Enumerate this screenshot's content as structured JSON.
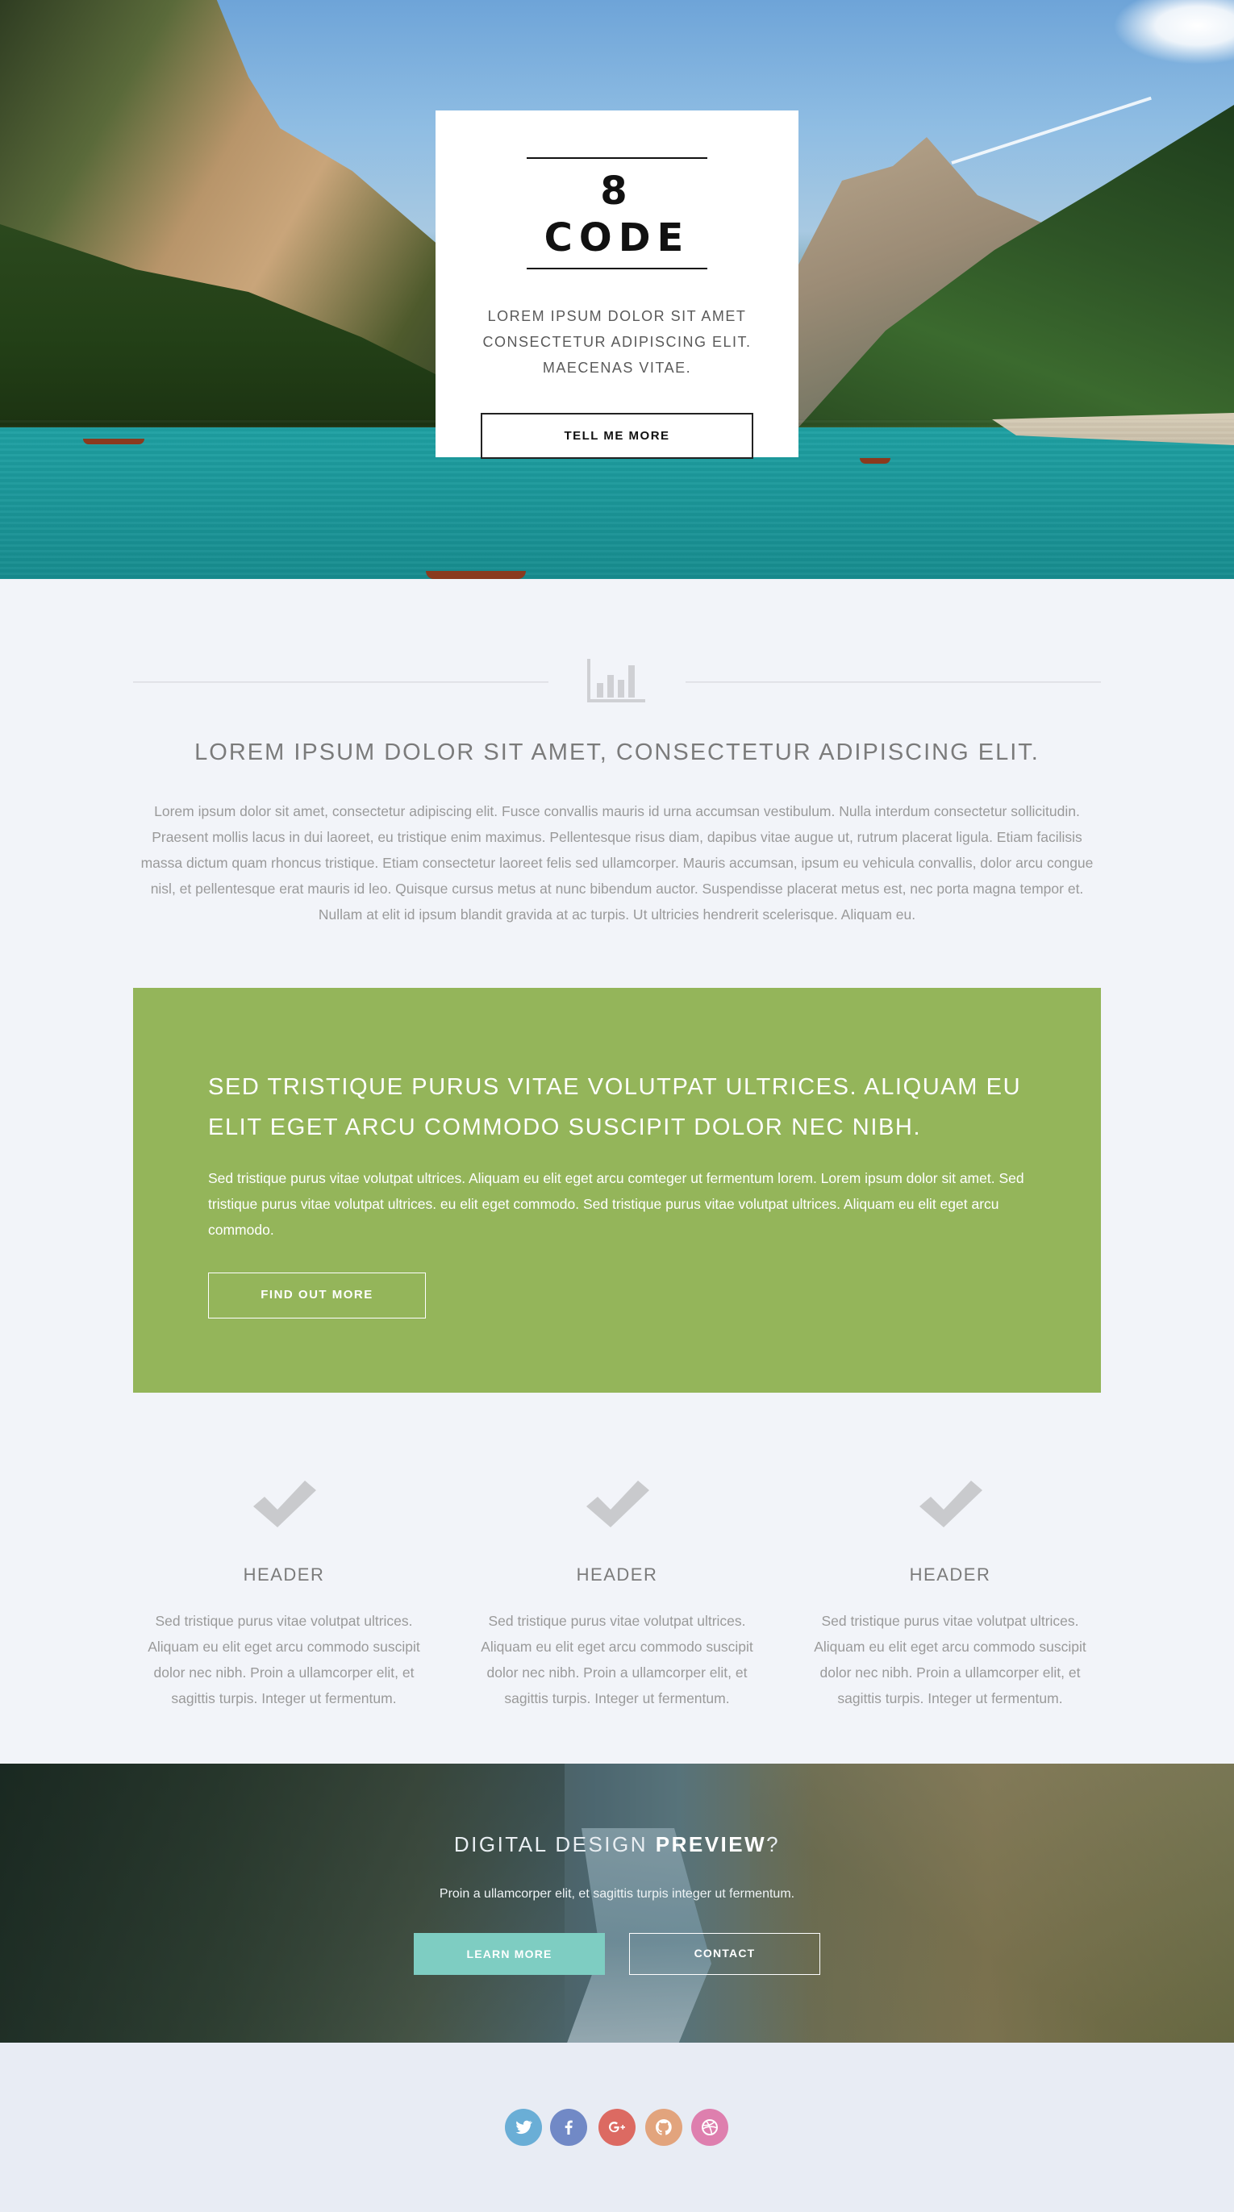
{
  "hero": {
    "logo": "8 CODE",
    "tagline": "LOREM IPSUM DOLOR SIT AMET CONSECTETUR ADIPISCING ELIT. MAECENAS VITAE.",
    "button_label": "TELL ME MORE"
  },
  "intro": {
    "icon": "bar-chart-icon",
    "title": "LOREM IPSUM DOLOR SIT AMET, CONSECTETUR ADIPISCING ELIT.",
    "body": "Lorem ipsum dolor sit amet, consectetur adipiscing elit. Fusce convallis mauris id urna accumsan vestibulum. Nulla interdum consectetur sollicitudin. Praesent mollis lacus in dui laoreet, eu tristique enim maximus. Pellentesque risus diam, dapibus vitae augue ut, rutrum placerat ligula. Etiam facilisis massa dictum quam rhoncus tristique. Etiam consectetur laoreet felis sed ullamcorper. Mauris accumsan, ipsum eu vehicula convallis, dolor arcu congue nisl, et pellentesque erat mauris id leo. Quisque cursus metus at nunc bibendum auctor. Suspendisse placerat metus est, nec porta magna tempor et. Nullam at elit id ipsum blandit gravida at ac turpis. Ut ultricies hendrerit scelerisque. Aliquam eu."
  },
  "promo": {
    "title": "SED TRISTIQUE PURUS VITAE VOLUTPAT ULTRICES. ALIQUAM EU ELIT EGET ARCU COMMODO SUSCIPIT DOLOR NEC NIBH.",
    "body": "Sed tristique purus vitae volutpat ultrices. Aliquam eu elit eget arcu comteger ut fermentum lorem. Lorem ipsum dolor sit amet. Sed tristique purus vitae volutpat ultrices. eu elit eget commodo. Sed tristique purus vitae volutpat ultrices. Aliquam eu elit eget arcu commodo.",
    "button_label": "FIND OUT MORE",
    "background_color": "#94b55a"
  },
  "features": [
    {
      "icon": "checkmark-icon",
      "header": "HEADER",
      "text": "Sed tristique purus vitae volutpat ultrices. Aliquam eu elit eget arcu commodo suscipit dolor nec nibh. Proin a ullamcorper elit, et sagittis turpis. Integer ut fermentum."
    },
    {
      "icon": "checkmark-icon",
      "header": "HEADER",
      "text": "Sed tristique purus vitae volutpat ultrices. Aliquam eu elit eget arcu commodo suscipit dolor nec nibh. Proin a ullamcorper elit, et sagittis turpis. Integer ut fermentum."
    },
    {
      "icon": "checkmark-icon",
      "header": "HEADER",
      "text": "Sed tristique purus vitae volutpat ultrices. Aliquam eu elit eget arcu commodo suscipit dolor nec nibh. Proin a ullamcorper elit, et sagittis turpis. Integer ut fermentum."
    }
  ],
  "banner": {
    "title_light": "DIGITAL DESIGN ",
    "title_strong": "PREVIEW",
    "title_end": "?",
    "subtitle": "Proin a ullamcorper elit, et sagittis turpis integer ut fermentum.",
    "learn_label": "LEARN MORE",
    "contact_label": "CONTACT",
    "accent_color": "#7ecdc2"
  },
  "footer": {
    "social": [
      {
        "icon": "twitter-icon",
        "color": "#6aaed6"
      },
      {
        "icon": "facebook-icon",
        "color": "#7189c6"
      },
      {
        "icon": "google-plus-icon",
        "color": "#dc6a62"
      },
      {
        "icon": "github-icon",
        "color": "#e2a47d"
      },
      {
        "icon": "dribbble-icon",
        "color": "#de7fae"
      }
    ]
  }
}
